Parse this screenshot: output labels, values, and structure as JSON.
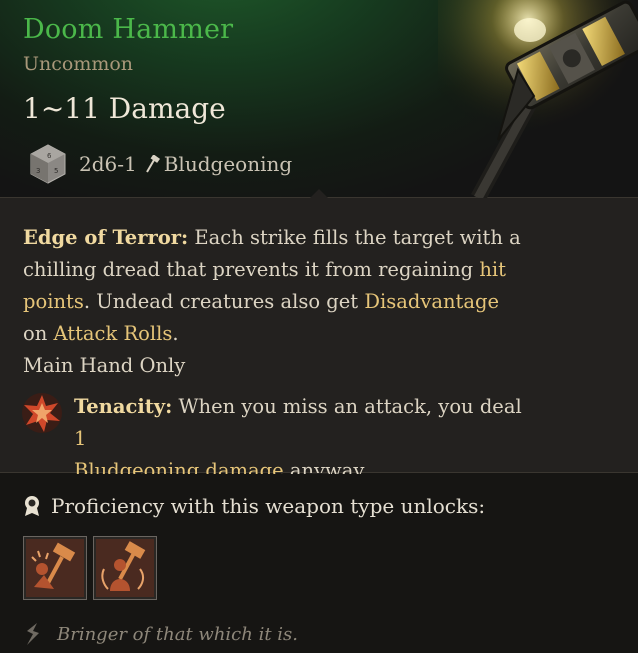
{
  "item": {
    "name": "Doom Hammer",
    "rarity": "Uncommon",
    "damage": "1~11 Damage",
    "dice": "2d6-1",
    "damage_type": "Bludgeoning"
  },
  "passive": {
    "name": "Edge of Terror:",
    "text_1": " Each strike fills the target with a chilling dread that prevents it from regaining ",
    "hit_points_1": "hit",
    "hit_points_2": "points",
    "text_2": ". Undead creatures also get ",
    "disadvantage": "Disadvantage",
    "text_3": " on ",
    "attack_rolls": "Attack Rolls",
    "text_4": "."
  },
  "restriction": "Main Hand Only",
  "tenacity": {
    "name": "Tenacity:",
    "text_1": " When you miss an attack, you deal ",
    "amount": "1",
    "damage_word": "Bludgeoning damage",
    "text_2": " anyway."
  },
  "proficiency": {
    "label": "Proficiency with this weapon type unlocks:",
    "actions": [
      "concussive-smash",
      "rush-attack"
    ]
  },
  "flavor": "Bringer of that which it is.",
  "colors": {
    "name_green": "#4bb84a",
    "rarity": "#a9987a",
    "highlight": "#e6c579",
    "text": "#dcd4c3"
  }
}
